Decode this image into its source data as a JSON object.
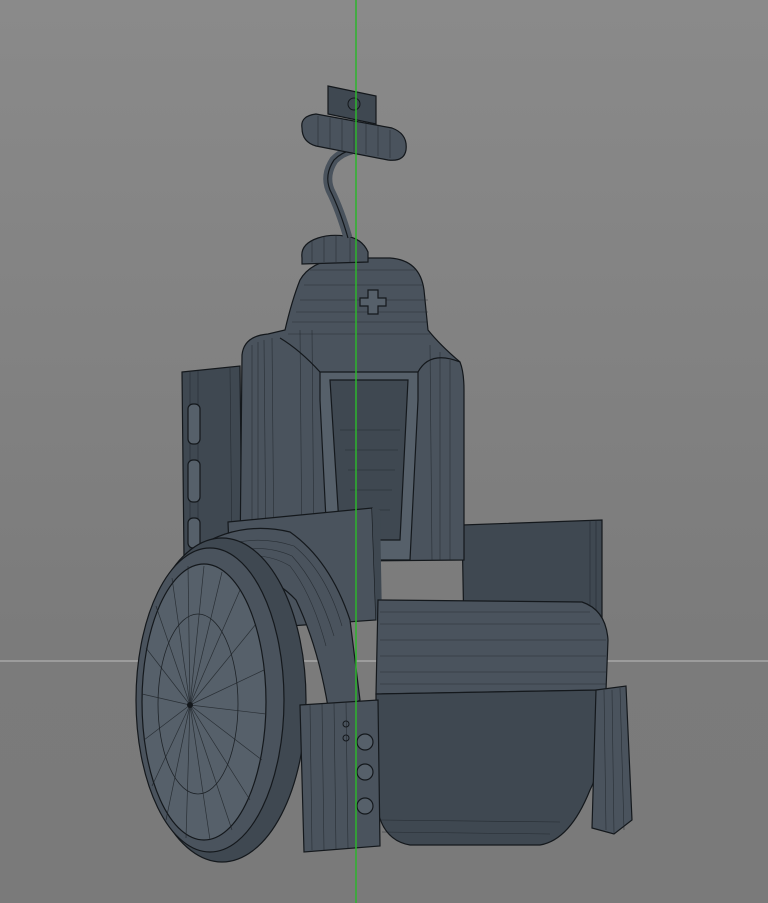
{
  "viewport": {
    "background_color": "#808080",
    "y_axis_color": "#2db52d",
    "horizon_color": "#9a9a9a",
    "model_color": "#4a535d",
    "wire_color": "#1e2328"
  },
  "icons": {
    "joystick": "joystick-icon",
    "cross": "plus-cross-icon"
  }
}
